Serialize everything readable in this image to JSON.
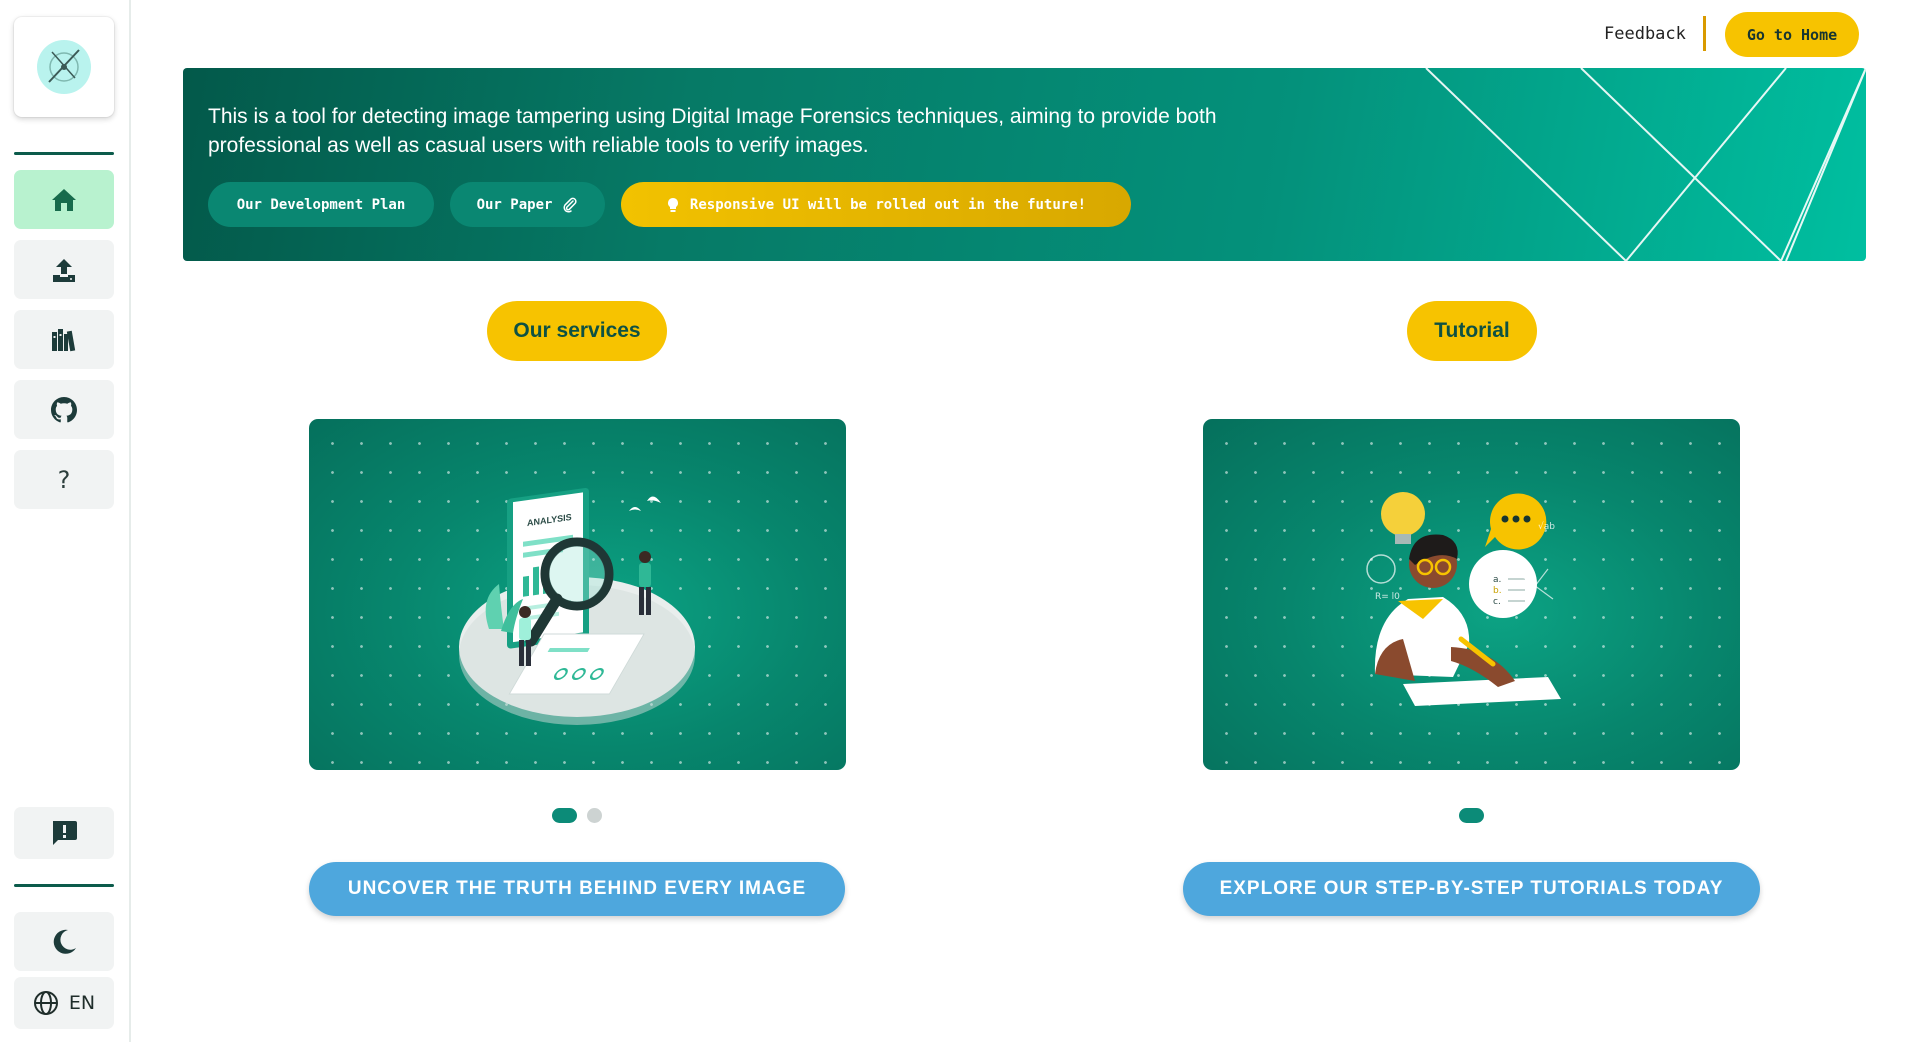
{
  "header": {
    "feedback_label": "Feedback",
    "go_home_label": "Go to Home"
  },
  "sidebar": {
    "items": [
      {
        "name": "home",
        "icon": "home-icon"
      },
      {
        "name": "upload",
        "icon": "upload-icon"
      },
      {
        "name": "library",
        "icon": "library-icon"
      },
      {
        "name": "github",
        "icon": "github-icon"
      },
      {
        "name": "help",
        "icon": "question-icon",
        "glyph": "?"
      }
    ],
    "feedback_icon": "comment-alert-icon",
    "theme_icon": "moon-icon",
    "language": "EN"
  },
  "banner": {
    "description": "This is a tool for detecting image tampering using Digital Image Forensics techniques, aiming to provide both professional as well as casual users with reliable tools to verify images.",
    "development_plan_label": "Our Development Plan",
    "paper_label": "Our Paper",
    "notice_label": "Responsive UI will be rolled out in the future!"
  },
  "services": {
    "title": "Our services",
    "cta_label": "UNCOVER THE TRUTH BEHIND EVERY IMAGE",
    "slides_total": 2,
    "slide_active": 1,
    "card_label": "ANALYSIS"
  },
  "tutorial": {
    "title": "Tutorial",
    "cta_label": "EXPLORE OUR STEP-BY-STEP TUTORIALS TODAY",
    "slides_total": 1,
    "slide_active": 1,
    "quiz_options": [
      "a.",
      "b.",
      "c."
    ]
  },
  "colors": {
    "accent_yellow": "#f7c300",
    "primary_green": "#0a8772",
    "cta_blue": "#4ea7dd",
    "active_nav": "#b8f2cf"
  }
}
